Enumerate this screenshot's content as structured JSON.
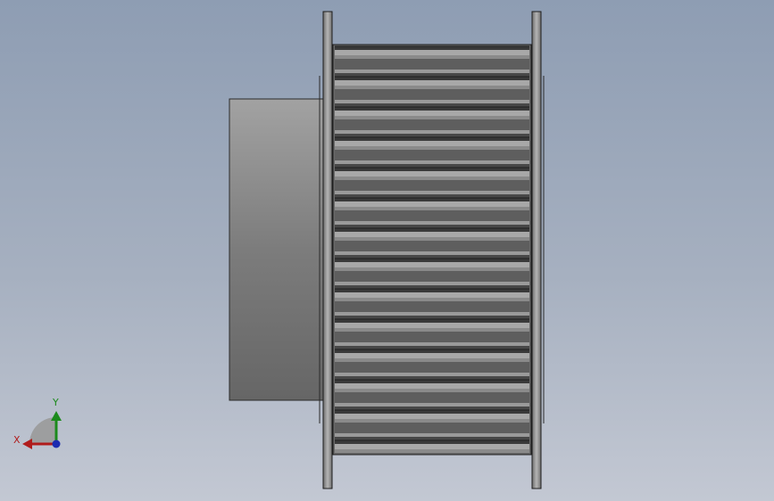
{
  "viewport": {
    "background_top": "#8e9db3",
    "background_bottom": "#c3c8d3"
  },
  "model": {
    "hub_color": "#7a7a7a",
    "flange_color": "#8a8a8a",
    "tooth_dark": "#5c5c5c",
    "tooth_light": "#a9a9a9",
    "edge_color": "#1e1e1e"
  },
  "triad": {
    "x_label": "X",
    "y_label": "Y",
    "x_color": "#b01c1c",
    "y_color": "#1c8a1c",
    "z_color": "#1c2ab0"
  }
}
